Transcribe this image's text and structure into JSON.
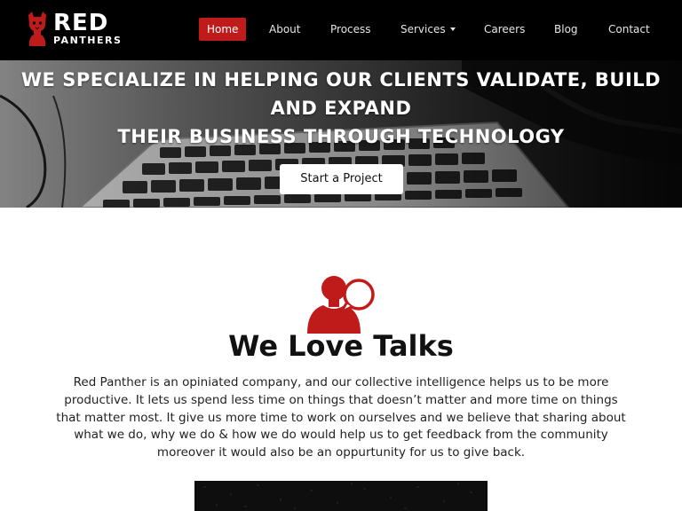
{
  "brand": {
    "name": "RED",
    "subtitle": "PANTHERS",
    "logo_icon": "panther-cat-icon",
    "accent_color": "#c01b1b"
  },
  "nav": {
    "items": [
      {
        "label": "Home",
        "active": true
      },
      {
        "label": "About",
        "active": false
      },
      {
        "label": "Process",
        "active": false
      },
      {
        "label": "Services",
        "active": false,
        "has_dropdown": true
      },
      {
        "label": "Careers",
        "active": false
      },
      {
        "label": "Blog",
        "active": false
      },
      {
        "label": "Contact",
        "active": false
      }
    ]
  },
  "hero": {
    "title_line1": "WE SPECIALIZE IN HELPING OUR CLIENTS VALIDATE, BUILD",
    "title_line2": "AND EXPAND",
    "title_line3": "THEIR BUSINESS THROUGH TECHNOLOGY",
    "cta_label": "Start a Project",
    "background": "keyboard-photo"
  },
  "talks": {
    "icon": "person-speech-bubble-icon",
    "title": "We Love Talks",
    "body": "Red Panther is an opiniated company, and our collective intelligence helps us to be more productive. It lets us spend less time on things that doesn’t matter and more time on things that matter most. It give us more time to work on ourselves and we believe that sharing about what we do, why we do & how we do would help us to get feedback from the community moreover it would also be an oppurtunity for us to give back."
  }
}
